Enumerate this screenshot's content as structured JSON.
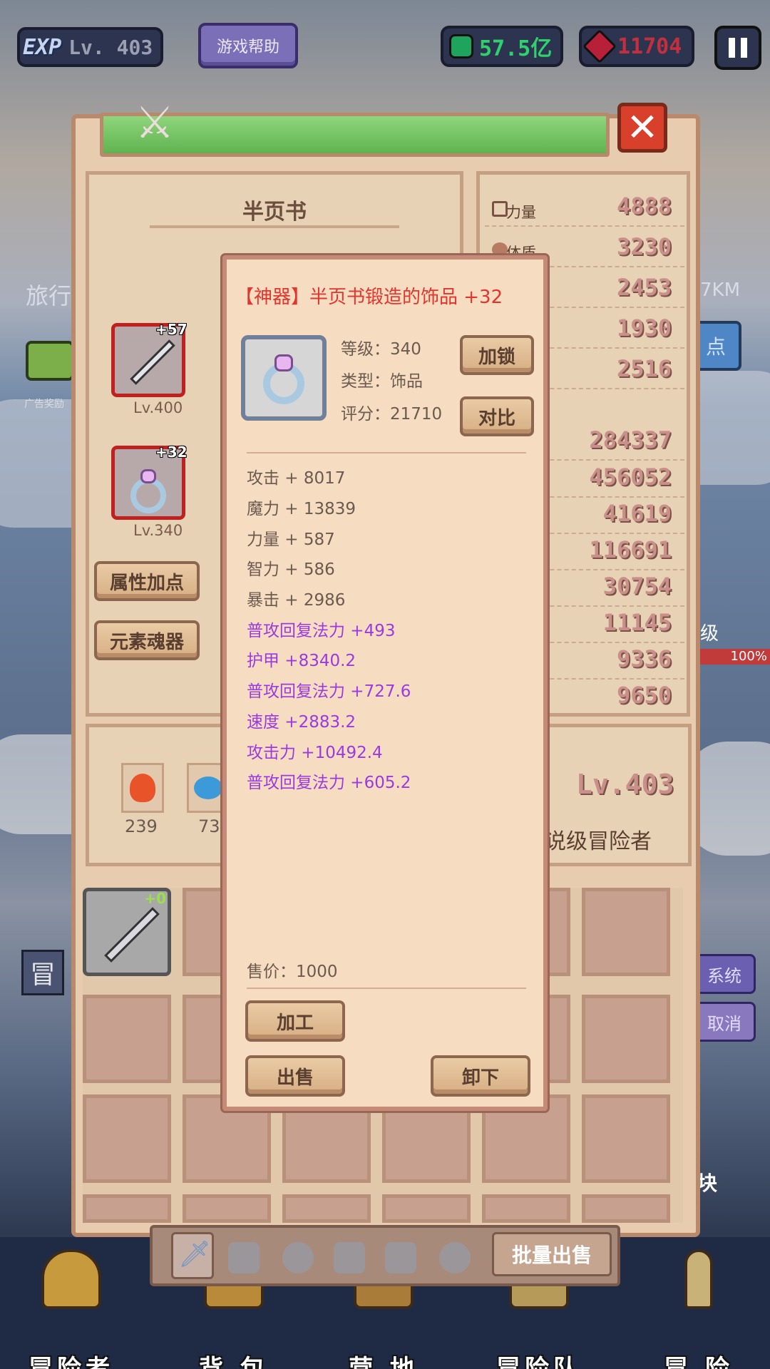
{
  "hud": {
    "exp_label": "EXP",
    "level": "Lv. 403",
    "help": "游戏帮助",
    "green_currency": "57.5亿",
    "red_currency": "11704"
  },
  "colors": {
    "accent_red": "#e3342e",
    "purple_attr": "#9a3ae0",
    "panel_bg": "#e7ccb0"
  },
  "character": {
    "name": "半页书",
    "weapon_plus": "+57",
    "weapon_level": "Lv.400",
    "ring_plus": "+32",
    "ring_level": "Lv.340",
    "attr_points_btn": "属性加点",
    "elemental_btn": "元素魂器"
  },
  "stats": [
    {
      "label": "力量",
      "value": "4888"
    },
    {
      "label": "体质",
      "value": "3230"
    },
    {
      "label": "",
      "value": "2453"
    },
    {
      "label": "",
      "value": "1930"
    },
    {
      "label": "",
      "value": "2516"
    },
    {
      "label": "",
      "value": "284337"
    },
    {
      "label": "",
      "value": "456052"
    },
    {
      "label": "",
      "value": "41619"
    },
    {
      "label": "",
      "value": "116691"
    },
    {
      "label": "",
      "value": "30754"
    },
    {
      "label": "",
      "value": "11145"
    },
    {
      "label": "",
      "value": "9336"
    },
    {
      "label": "",
      "value": "9650"
    }
  ],
  "adventurer": {
    "level": "Lv.403",
    "title": "说级冒险者"
  },
  "elements": [
    {
      "count": "239"
    },
    {
      "count": "73"
    }
  ],
  "side_labels": {
    "travel": "旅行",
    "ad_reward": "广告奖励",
    "km": "7KM",
    "point": "点",
    "level": "级",
    "percent": "100%",
    "system": "系统",
    "cancel": "取消",
    "block": "块",
    "adventure_tab": "冒"
  },
  "inventory": {
    "first_slot_plus": "+0"
  },
  "tabs": {
    "batch_sell": "批量出售"
  },
  "nav": [
    {
      "label": "冒险者"
    },
    {
      "label": "背 包"
    },
    {
      "label": "营 地"
    },
    {
      "label": "冒险队"
    },
    {
      "label": "冒 险"
    }
  ],
  "item": {
    "title": "【神器】半页书锻造的饰品 +32",
    "level": "等级：340",
    "type": "类型：饰品",
    "score": "评分：21710",
    "lock_btn": "加锁",
    "compare_btn": "对比",
    "base_attrs": [
      "攻击 + 8017",
      "魔力 + 13839",
      "力量 + 587",
      "智力 + 586",
      "暴击 + 2986"
    ],
    "bonus_attrs": [
      "普攻回复法力 +493",
      "护甲 +8340.2",
      "普攻回复法力 +727.6",
      "速度 +2883.2",
      "攻击力 +10492.4",
      "普攻回复法力 +605.2"
    ],
    "price": "售价：1000",
    "craft_btn": "加工",
    "sell_btn": "出售",
    "unequip_btn": "卸下"
  }
}
